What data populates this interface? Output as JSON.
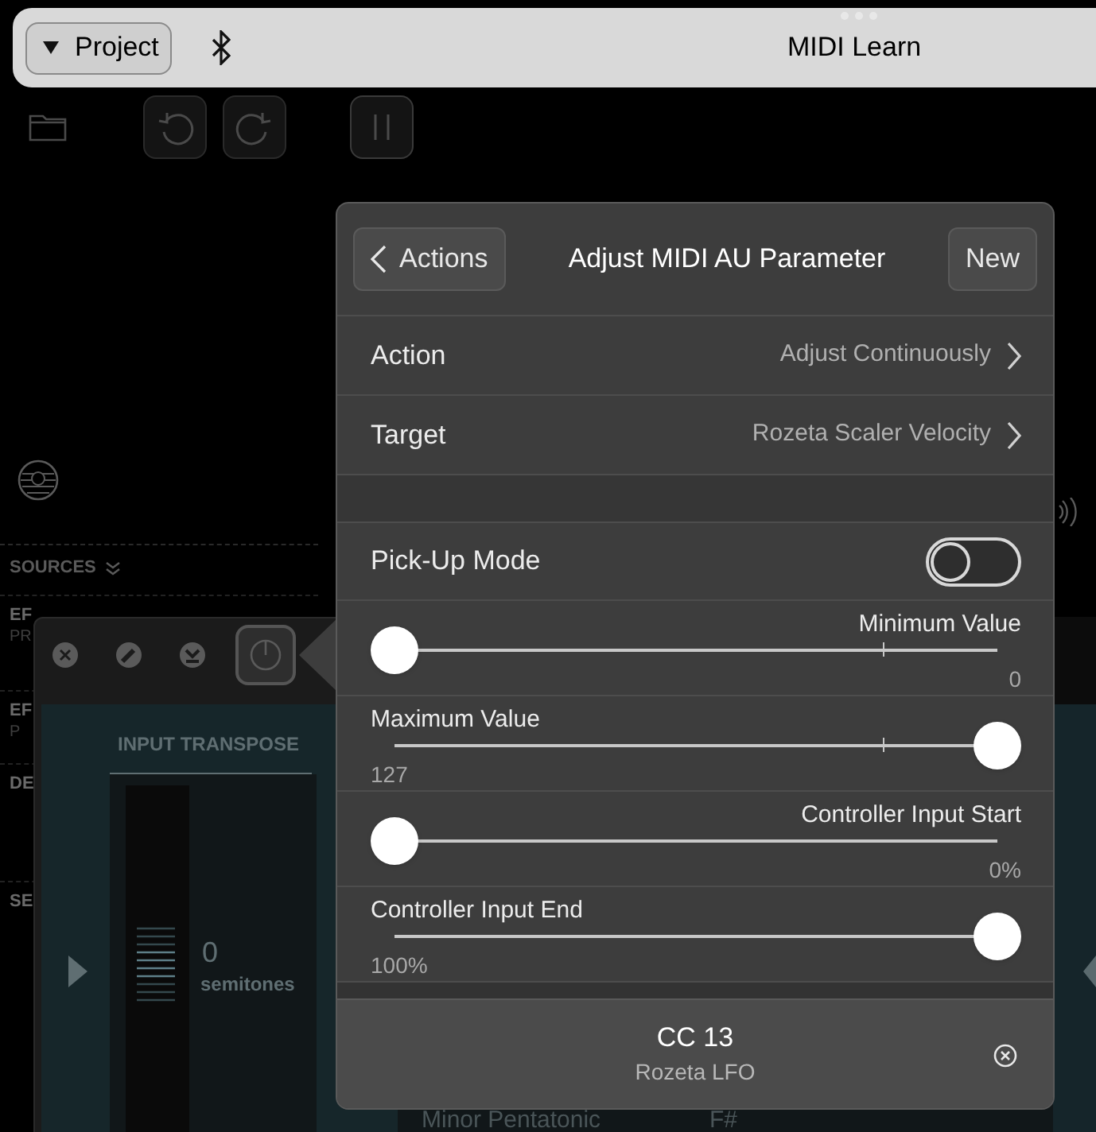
{
  "top_bar": {
    "project_button": "Project",
    "title": "MIDI Learn"
  },
  "sidebar": {
    "section": "SOURCES",
    "items": [
      {
        "label": "EF",
        "sub": "PR"
      },
      {
        "label": "EF",
        "sub": "P"
      },
      {
        "label": "DE"
      },
      {
        "label": "SE"
      }
    ]
  },
  "plugin": {
    "toolbar": [
      {
        "kind": "close",
        "selected": false
      },
      {
        "kind": "edit",
        "selected": false
      },
      {
        "kind": "download",
        "selected": false
      },
      {
        "kind": "power",
        "selected": true
      }
    ],
    "title": "INPUT TRANSPOSE",
    "value": "0",
    "unit": "semitones",
    "footer_cells": [
      "Minor Pentatonic",
      "F#"
    ]
  },
  "popover": {
    "back_button": "Actions",
    "title": "Adjust MIDI AU Parameter",
    "new_button": "New",
    "rows": [
      {
        "label": "Action",
        "value": "Adjust Continuously"
      },
      {
        "label": "Target",
        "value": "Rozeta Scaler Velocity"
      }
    ],
    "pickup": {
      "label": "Pick-Up Mode",
      "on": false
    },
    "sliders": [
      {
        "label": "Minimum Value",
        "value": "0",
        "level": 0,
        "marker": true
      },
      {
        "label": "Maximum Value",
        "value": "127",
        "level": 1,
        "marker": true
      },
      {
        "label": "Controller Input Start",
        "value": "0%",
        "level": 0,
        "marker": false
      },
      {
        "label": "Controller Input End",
        "value": "100%",
        "level": 1,
        "marker": false
      }
    ],
    "source": {
      "title": "CC 13",
      "subtitle": "Rozeta LFO"
    }
  }
}
